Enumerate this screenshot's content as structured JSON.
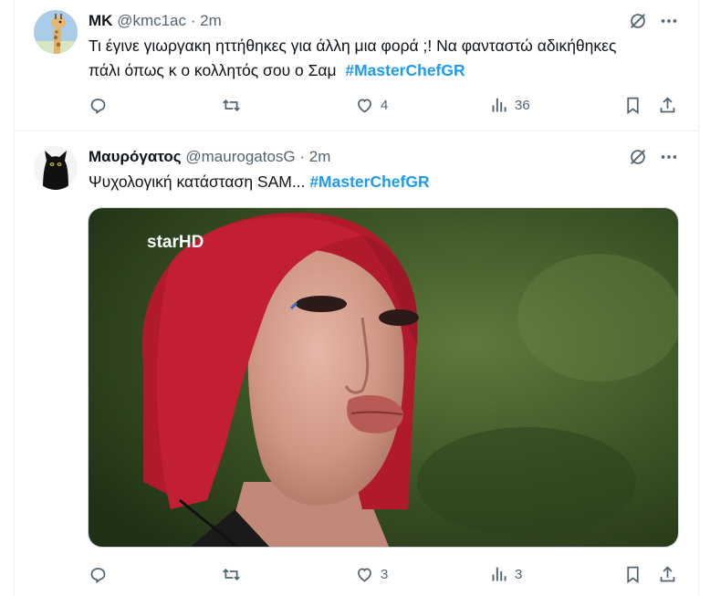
{
  "tweets": [
    {
      "name": "ΜΚ",
      "handle": "@kmc1ac",
      "dot": "·",
      "time": "2m",
      "text_line1": "Τι έγινε γιωργακη ηττήθηκες για άλλη μια φορά ;! Να φανταστώ αδικήθηκες",
      "text_line2": "πάλι όπως κ ο κολλητός σου ο Σαμ",
      "hashtag": "#MasterChefGR",
      "likes": "4",
      "views": "36"
    },
    {
      "name": "Μαυρόγατος",
      "handle": "@maurogatosG",
      "dot": "·",
      "time": "2m",
      "text": "Ψυχολογική κατάσταση SAM...",
      "hashtag": "#MasterChefGR",
      "media_watermark": "starHD",
      "likes": "3",
      "views": "3"
    }
  ],
  "icons": {
    "grok": "grok-icon",
    "more": "more-icon",
    "reply": "reply-icon",
    "retweet": "retweet-icon",
    "like": "heart-icon",
    "views": "views-icon",
    "bookmark": "bookmark-icon",
    "share": "share-icon"
  },
  "colors": {
    "text": "#0f1419",
    "muted": "#536471",
    "link": "#1d9bf0",
    "border": "#eff3f4"
  }
}
